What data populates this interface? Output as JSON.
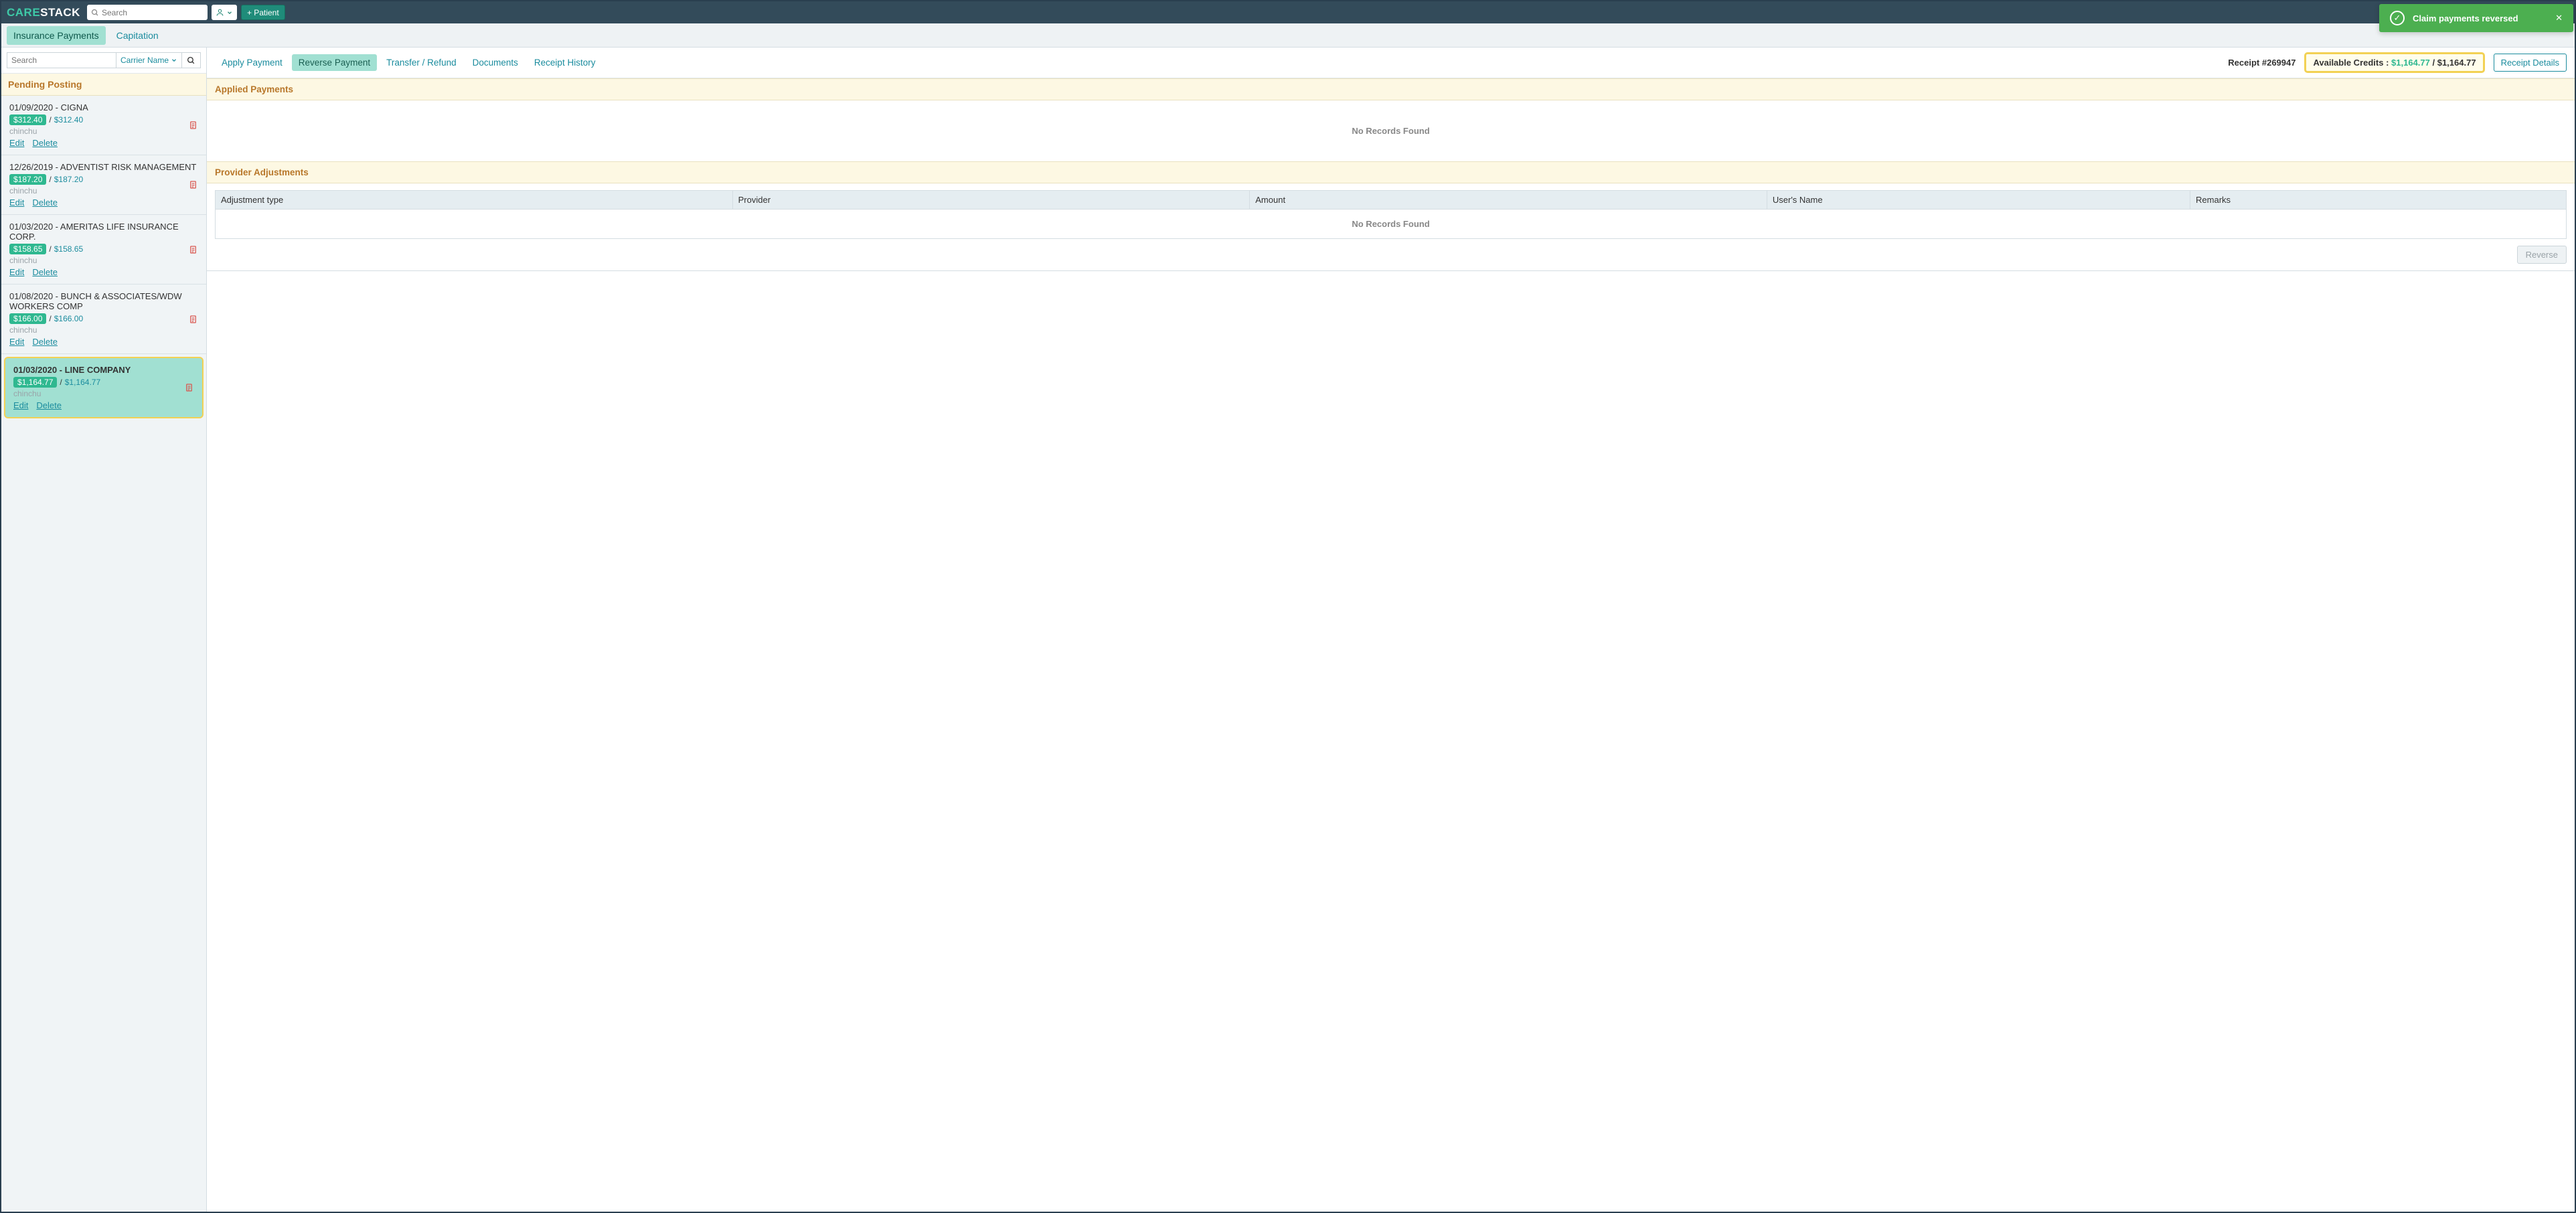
{
  "topbar": {
    "logo_care": "CARE",
    "logo_stack": "STACK",
    "search_placeholder": "Search",
    "add_patient_label": "+ Patient"
  },
  "toast": {
    "message": "Claim payments reversed"
  },
  "subnav": {
    "tabs": [
      "Insurance Payments",
      "Capitation"
    ],
    "active_index": 0
  },
  "sidebar": {
    "search_placeholder": "Search",
    "sort_label": "Carrier Name",
    "pending_header": "Pending Posting",
    "items": [
      {
        "title": "01/09/2020 - CIGNA",
        "chip": "$312.40",
        "total": "$312.40",
        "user": "chinchu",
        "edit": "Edit",
        "del": "Delete",
        "selected": false
      },
      {
        "title": "12/26/2019 - ADVENTIST RISK MANAGEMENT",
        "chip": "$187.20",
        "total": "$187.20",
        "user": "chinchu",
        "edit": "Edit",
        "del": "Delete",
        "selected": false
      },
      {
        "title": "01/03/2020 - AMERITAS LIFE INSURANCE CORP.",
        "chip": "$158.65",
        "total": "$158.65",
        "user": "chinchu",
        "edit": "Edit",
        "del": "Delete",
        "selected": false
      },
      {
        "title": "01/08/2020 - BUNCH & ASSOCIATES/WDW WORKERS COMP",
        "chip": "$166.00",
        "total": "$166.00",
        "user": "chinchu",
        "edit": "Edit",
        "del": "Delete",
        "selected": false
      },
      {
        "title": "01/03/2020 - LINE COMPANY",
        "chip": "$1,164.77",
        "total": "$1,164.77",
        "user": "chinchu",
        "edit": "Edit",
        "del": "Delete",
        "selected": true
      }
    ]
  },
  "content": {
    "toolbar": {
      "apply": "Apply Payment",
      "reverse": "Reverse Payment",
      "transfer": "Transfer / Refund",
      "documents": "Documents",
      "receipt_history": "Receipt History"
    },
    "receipt_label": "Receipt #269947",
    "credits_label": "Available Credits : ",
    "credits_value": "$1,164.77",
    "credits_sep": " / ",
    "credits_total": "$1,164.77",
    "receipt_details_label": "Receipt Details",
    "applied_header": "Applied Payments",
    "no_records": "No Records Found",
    "provider_header": "Provider Adjustments",
    "table_headers": {
      "adj_type": "Adjustment type",
      "provider": "Provider",
      "amount": "Amount",
      "user": "User's Name",
      "remarks": "Remarks"
    },
    "reverse_btn": "Reverse"
  }
}
